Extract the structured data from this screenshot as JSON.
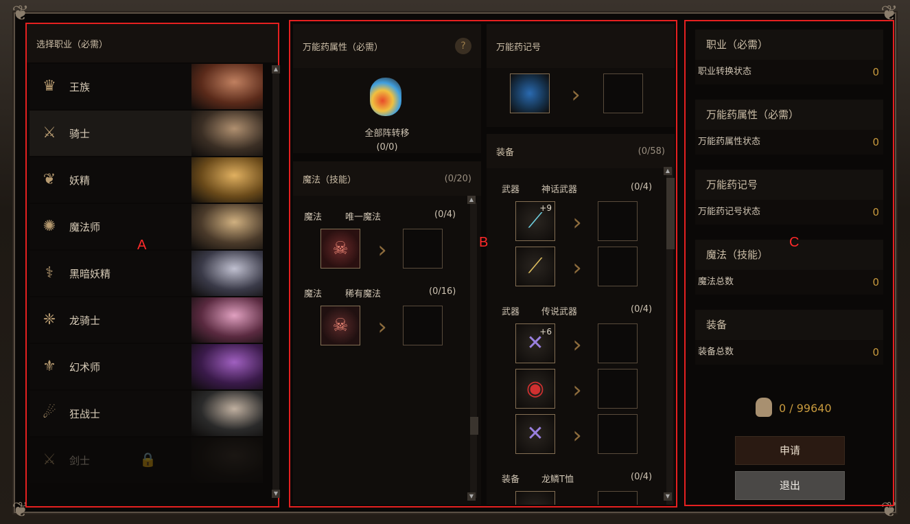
{
  "panelA": {
    "header": "选择职业（必需）",
    "classes": [
      {
        "name": "王族",
        "icon": "crown-icon"
      },
      {
        "name": "骑士",
        "icon": "knight-icon"
      },
      {
        "name": "妖精",
        "icon": "elf-icon"
      },
      {
        "name": "魔法师",
        "icon": "wizard-icon"
      },
      {
        "name": "黑暗妖精",
        "icon": "dark-elf-icon"
      },
      {
        "name": "龙骑士",
        "icon": "dragon-knight-icon"
      },
      {
        "name": "幻术师",
        "icon": "illusionist-icon"
      },
      {
        "name": "狂战士",
        "icon": "berserker-icon"
      },
      {
        "name": "剑士",
        "icon": "swordsman-icon",
        "locked": true
      }
    ],
    "annotation": "A"
  },
  "panelB": {
    "potion_header": "万能药属性（必需）",
    "help_label": "?",
    "potion_name": "全部阵转移",
    "potion_count": "(0/0)",
    "mark_header": "万能药记号",
    "magic_header": "魔法（技能）",
    "magic_count": "(0/20)",
    "magic_groups": [
      {
        "type": "魔法",
        "name": "唯一魔法",
        "count": "(0/4)"
      },
      {
        "type": "魔法",
        "name": "稀有魔法",
        "count": "(0/16)"
      }
    ],
    "equip_header": "装备",
    "equip_count": "(0/58)",
    "equip_groups": [
      {
        "type": "武器",
        "name": "神话武器",
        "count": "(0/4)",
        "enchant": "+9"
      },
      {
        "type": "武器",
        "name": "传说武器",
        "count": "(0/4)",
        "enchant": "+6"
      },
      {
        "type": "装备",
        "name": "龙鳞T恤",
        "count": "(0/4)"
      }
    ],
    "annotation": "B"
  },
  "panelC": {
    "stats": [
      {
        "title": "职业（必需）",
        "row_label": "职业转换状态",
        "value": "0"
      },
      {
        "title": "万能药属性（必需）",
        "row_label": "万能药属性状态",
        "value": "0"
      },
      {
        "title": "万能药记号",
        "row_label": "万能药记号状态",
        "value": "0"
      },
      {
        "title": "魔法（技能）",
        "row_label": "魔法总数",
        "value": "0"
      },
      {
        "title": "装备",
        "row_label": "装备总数",
        "value": "0"
      }
    ],
    "currency": "0 / 99640",
    "apply_label": "申请",
    "exit_label": "退出",
    "annotation": "C"
  },
  "colors": {
    "highlight": "#e62020",
    "gold": "#c89a3e"
  }
}
